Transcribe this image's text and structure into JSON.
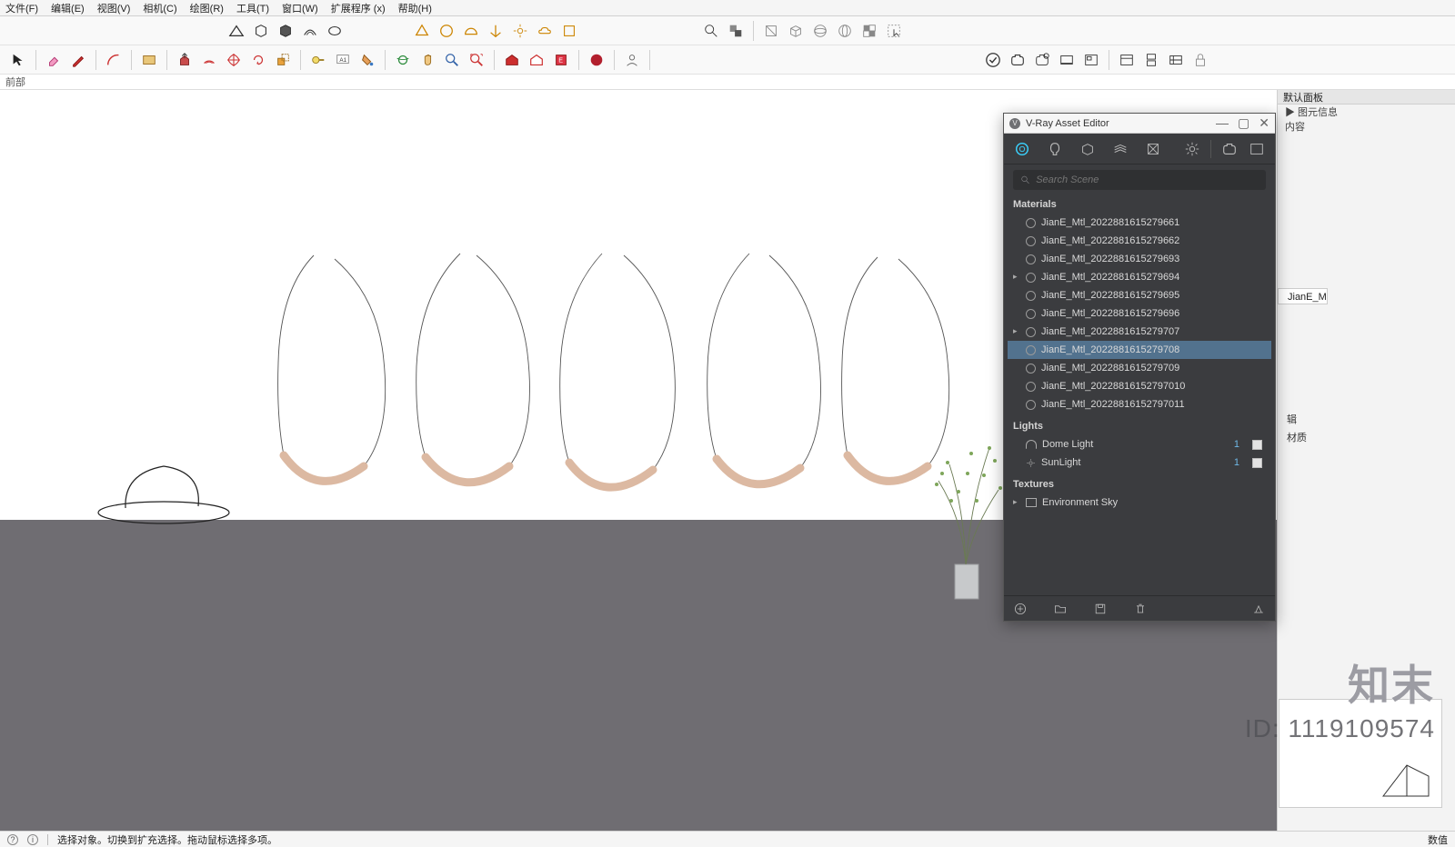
{
  "menubar": {
    "items": [
      "文件(F)",
      "编辑(E)",
      "视图(V)",
      "相机(C)",
      "绘图(R)",
      "工具(T)",
      "窗口(W)",
      "扩展程序 (x)",
      "帮助(H)"
    ]
  },
  "toolbar": {
    "row1_left_count": 17,
    "row1_right_count": 9,
    "row2_count": 22,
    "row2_right_count": 10
  },
  "subheader": {
    "label": "前部"
  },
  "right_panel": {
    "title": "默认面板",
    "subtitle": "▶ 图元信息",
    "content": "内容",
    "material_field": "JianE_M",
    "edit_label": "辑",
    "material_tab": "材质"
  },
  "vray": {
    "title": "V-Ray Asset Editor",
    "search_placeholder": "Search Scene",
    "sections": {
      "materials": {
        "label": "Materials",
        "items": [
          {
            "name": "JianE_Mtl_2022881615279661",
            "expandable": false
          },
          {
            "name": "JianE_Mtl_2022881615279662",
            "expandable": false
          },
          {
            "name": "JianE_Mtl_2022881615279693",
            "expandable": false
          },
          {
            "name": "JianE_Mtl_2022881615279694",
            "expandable": true
          },
          {
            "name": "JianE_Mtl_2022881615279695",
            "expandable": false
          },
          {
            "name": "JianE_Mtl_2022881615279696",
            "expandable": false
          },
          {
            "name": "JianE_Mtl_2022881615279707",
            "expandable": true
          },
          {
            "name": "JianE_Mtl_2022881615279708",
            "expandable": false,
            "selected": true
          },
          {
            "name": "JianE_Mtl_2022881615279709",
            "expandable": false
          },
          {
            "name": "JianE_Mtl_20228816152797010",
            "expandable": false
          },
          {
            "name": "JianE_Mtl_20228816152797011",
            "expandable": false
          }
        ]
      },
      "lights": {
        "label": "Lights",
        "items": [
          {
            "name": "Dome Light",
            "type": "dome",
            "count": "1",
            "enabled": true
          },
          {
            "name": "SunLight",
            "type": "sun",
            "count": "1",
            "enabled": true
          }
        ]
      },
      "textures": {
        "label": "Textures",
        "items": [
          {
            "name": "Environment Sky",
            "expandable": true
          }
        ]
      }
    }
  },
  "statusbar": {
    "hint": "选择对象。切换到扩充选择。拖动鼠标选择多项。",
    "right": "数值"
  },
  "watermark": {
    "brand": "知末",
    "id_prefix": "ID: ",
    "id": "1119109574"
  }
}
